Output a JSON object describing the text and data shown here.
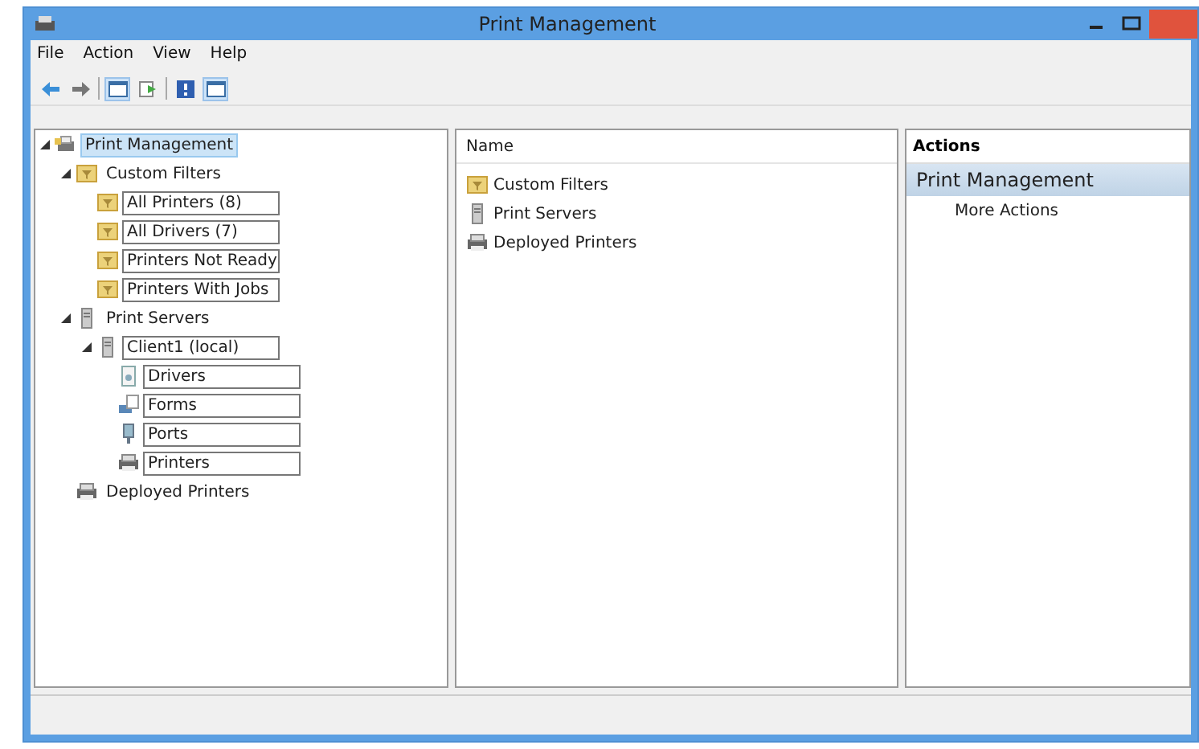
{
  "window": {
    "title": "Print Management"
  },
  "menu": [
    "File",
    "Action",
    "View",
    "Help"
  ],
  "toolbar": [
    {
      "kind": "back"
    },
    {
      "kind": "forward"
    },
    {
      "kind": "sep"
    },
    {
      "kind": "pane",
      "selected": true
    },
    {
      "kind": "export"
    },
    {
      "kind": "sep"
    },
    {
      "kind": "help"
    },
    {
      "kind": "pane",
      "selected": true
    }
  ],
  "tree": [
    {
      "label": "Print Management",
      "kind": "root",
      "selected": true,
      "boxed": false,
      "expanded": true,
      "children": [
        {
          "label": "Custom Filters",
          "kind": "filter",
          "selected": false,
          "boxed": false,
          "expanded": true,
          "children": [
            {
              "label": "All Printers (8)",
              "kind": "filter",
              "selected": false,
              "boxed": true
            },
            {
              "label": "All Drivers (7)",
              "kind": "filter",
              "selected": false,
              "boxed": true
            },
            {
              "label": "Printers Not Ready",
              "kind": "filter",
              "selected": false,
              "boxed": true
            },
            {
              "label": "Printers With Jobs",
              "kind": "filter",
              "selected": false,
              "boxed": true
            }
          ]
        },
        {
          "label": "Print Servers",
          "kind": "server",
          "selected": false,
          "boxed": false,
          "expanded": true,
          "children": [
            {
              "label": "Client1 (local)",
              "kind": "server",
              "selected": false,
              "boxed": true,
              "expanded": true,
              "children": [
                {
                  "label": "Drivers",
                  "kind": "drivers",
                  "selected": false,
                  "boxed": true
                },
                {
                  "label": "Forms",
                  "kind": "forms",
                  "selected": false,
                  "boxed": true
                },
                {
                  "label": "Ports",
                  "kind": "ports",
                  "selected": false,
                  "boxed": true
                },
                {
                  "label": "Printers",
                  "kind": "printer",
                  "selected": false,
                  "boxed": true
                }
              ]
            }
          ]
        },
        {
          "label": "Deployed Printers",
          "kind": "printer",
          "selected": false,
          "boxed": false
        }
      ]
    }
  ],
  "list": {
    "columns": [
      "Name"
    ],
    "items": [
      {
        "label": "Custom Filters",
        "kind": "filter"
      },
      {
        "label": "Print Servers",
        "kind": "server"
      },
      {
        "label": "Deployed Printers",
        "kind": "printer"
      }
    ]
  },
  "actions": {
    "header": "Actions",
    "section": "Print Management",
    "items": [
      "More Actions"
    ]
  }
}
